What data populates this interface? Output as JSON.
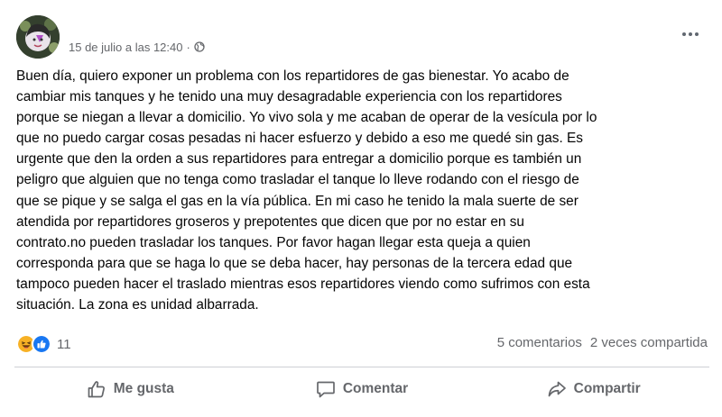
{
  "post": {
    "timestamp": "15 de julio a las 12:40",
    "separator": "·",
    "privacy_icon": "globe-icon",
    "menu_icon": "more-options-icon",
    "text": "Buen día, quiero exponer un problema con los repartidores de gas bienestar. Yo acabo de\ncambiar mis tanques y he tenido una muy desagradable experiencia con los repartidores\nporque se niegan a llevar a domicilio. Yo vivo sola y me acaban de operar de la vesícula por lo\nque no puedo cargar cosas pesadas ni hacer esfuerzo y debido a eso me quedé sin gas. Es\nurgente que den la orden a sus repartidores para entregar a domicilio porque es también un\npeligro que alguien que no tenga como trasladar el tanque lo lleve rodando con el riesgo de\nque se pique y se salga el gas en la vía pública. En mi caso he tenido la mala suerte de ser\natendida por repartidores groseros y prepotentes que dicen que por no estar en su\ncontrato.no pueden trasladar los tanques. Por favor hagan llegar esta queja a quien\ncorresponda para que se haga lo que se deba hacer, hay personas de la tercera edad que\ntampoco pueden hacer el traslado mientras esos repartidores viendo como sufrimos con esta\nsituación. La zona es unidad albarrada."
  },
  "reactions": {
    "icons": [
      "haha-reaction-icon",
      "like-reaction-icon"
    ],
    "count": "11"
  },
  "stats": {
    "comments": "5 comentarios",
    "shares": "2 veces compartida"
  },
  "actions": {
    "like": {
      "label": "Me gusta",
      "icon": "thumbs-up-icon"
    },
    "comment": {
      "label": "Comentar",
      "icon": "comment-bubble-icon"
    },
    "share": {
      "label": "Compartir",
      "icon": "share-arrow-icon"
    }
  },
  "colors": {
    "secondary_text": "#65676b",
    "like_blue": "#1877f2",
    "haha_yellow": "#f7b125",
    "divider": "#ced0d4"
  }
}
